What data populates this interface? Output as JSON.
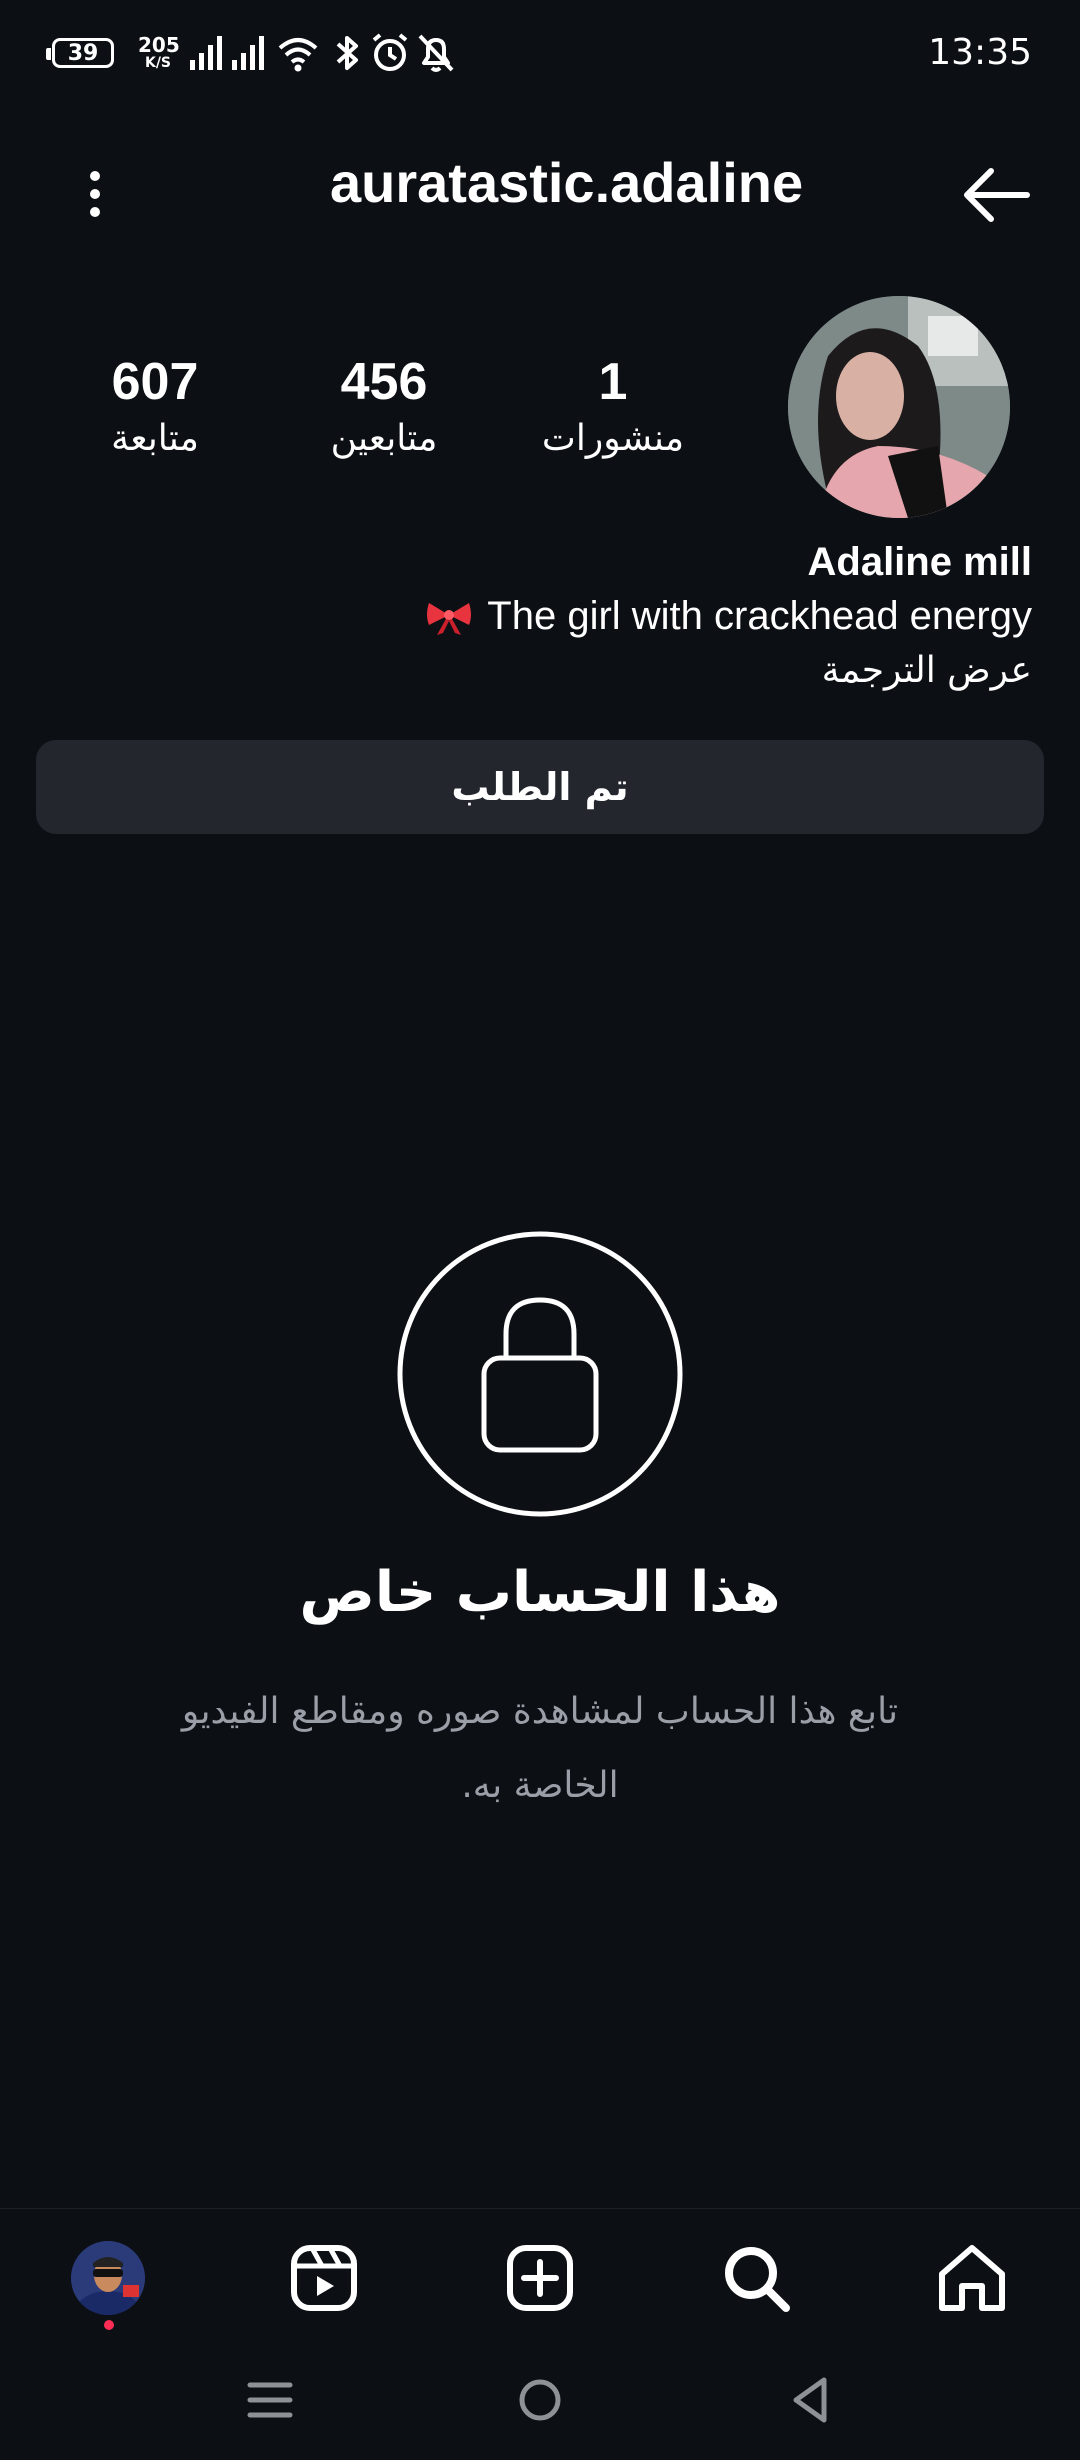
{
  "status_bar": {
    "battery": "39",
    "net_speed_value": "205",
    "net_speed_unit": "K/S",
    "time": "13:35",
    "icons": [
      "signal-icon",
      "signal-icon",
      "wifi-icon",
      "bluetooth-icon",
      "alarm-icon",
      "bell-off-icon"
    ]
  },
  "header": {
    "username": "auratastic.adaline",
    "menu_icon": "more-vertical-icon",
    "back_icon": "arrow-back-icon"
  },
  "profile": {
    "posts_count": "1",
    "posts_label": "منشورات",
    "followers_count": "456",
    "followers_label": "متابعين",
    "following_count": "607",
    "following_label": "متابعة",
    "display_name": "Adaline mill",
    "bio_text": "The girl with crackhead energy",
    "bio_emoji": "ribbon-icon",
    "translate_link": "عرض الترجمة",
    "request_button": "تم الطلب"
  },
  "private_notice": {
    "title": "هذا الحساب خاص",
    "message": "تابع هذا الحساب لمشاهدة صوره ومقاطع الفيديو الخاصة به."
  },
  "bottom_nav": {
    "items": [
      "profile-avatar",
      "reels-icon",
      "create-icon",
      "search-icon",
      "home-icon"
    ]
  },
  "system_nav": {
    "items": [
      "recents-icon",
      "home-circle-icon",
      "back-triangle-icon"
    ]
  },
  "colors": {
    "background": "#0c0f14",
    "button_bg": "#23262d",
    "muted_text": "#9a9ea6",
    "notification_dot": "#ff2d55"
  }
}
